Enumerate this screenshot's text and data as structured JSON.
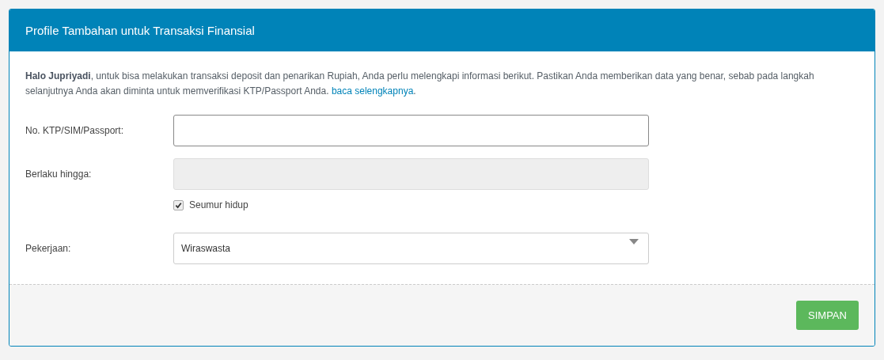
{
  "panel": {
    "title": "Profile Tambahan untuk Transaksi Finansial"
  },
  "intro": {
    "text": "**Halo Jupriyadi**, untuk bisa melakukan transaksi deposit dan penarikan Rupiah, Anda perlu melengkapi informasi berikut. Pastikan Anda memberikan data yang benar, sebab pada langkah selanjutnya Anda akan diminta untuk memverifikasi KTP/Passport Anda.",
    "link": "baca selengkapnya",
    "tail": "."
  },
  "fields": [
    {
      "kind": "text",
      "label": "No. KTP/SIM/Passport:",
      "disabled": false
    },
    {
      "kind": "text",
      "label": "Berlaku hingga:",
      "disabled": true
    },
    {
      "kind": "checkbox",
      "label": "Seumur hidup",
      "checked": true
    },
    {
      "kind": "select",
      "label": "Pekerjaan:",
      "value": "Wiraswasta"
    }
  ],
  "footer": {
    "button": "SIMPAN"
  }
}
